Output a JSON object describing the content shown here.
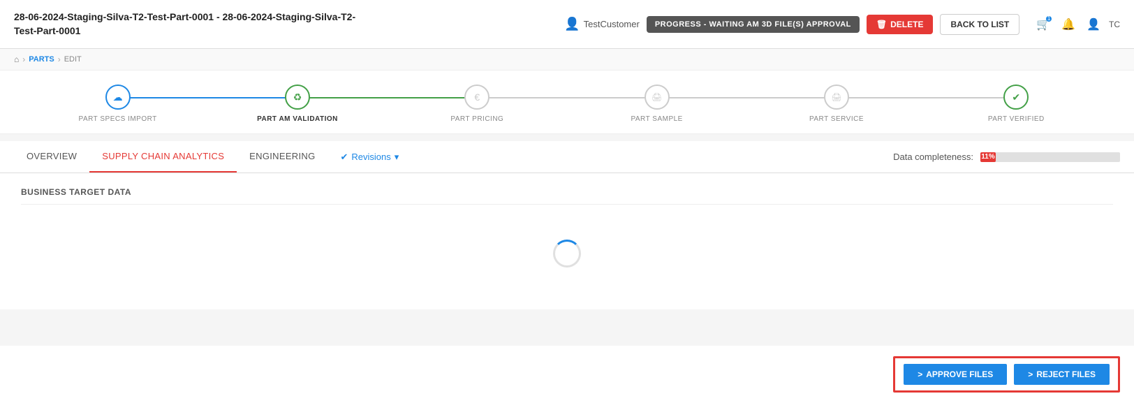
{
  "header": {
    "title": "28-06-2024-Staging-Silva-T2-Test-Part-0001 - 28-06-2024-Staging-Silva-T2-Test-Part-0001",
    "status_badge": "PROGRESS - WAITING AM 3D FILE(S) APPROVAL",
    "delete_label": "DELETE",
    "back_label": "BACK TO LIST",
    "user_name": "TestCustomer",
    "tc_label": "TC"
  },
  "breadcrumb": {
    "home_icon": "⌂",
    "parts_label": "PARTS",
    "current": "EDIT"
  },
  "steps": [
    {
      "label": "PART SPECS IMPORT",
      "icon": "☁",
      "state": "blue"
    },
    {
      "label": "PART AM VALIDATION",
      "icon": "♻",
      "state": "green",
      "bold": true
    },
    {
      "label": "PART PRICING",
      "icon": "€",
      "state": "default"
    },
    {
      "label": "PART SAMPLE",
      "icon": "🖨",
      "state": "default"
    },
    {
      "label": "PART SERVICE",
      "icon": "🖨",
      "state": "default"
    },
    {
      "label": "PART VERIFIED",
      "icon": "✔",
      "state": "default"
    }
  ],
  "tabs": {
    "items": [
      {
        "label": "OVERVIEW",
        "active": false
      },
      {
        "label": "SUPPLY CHAIN ANALYTICS",
        "active": true
      },
      {
        "label": "ENGINEERING",
        "active": false
      }
    ],
    "revisions_label": "Revisions",
    "revisions_icon": "✔",
    "dropdown_icon": "▾",
    "data_completeness_label": "Data completeness:",
    "completeness_value": "11%",
    "completeness_percent": 11
  },
  "section": {
    "title": "BUSINESS TARGET DATA"
  },
  "actions": {
    "approve_label": "APPROVE FILES",
    "reject_label": "REJECT FILES",
    "approve_icon": ">",
    "reject_icon": ">"
  }
}
